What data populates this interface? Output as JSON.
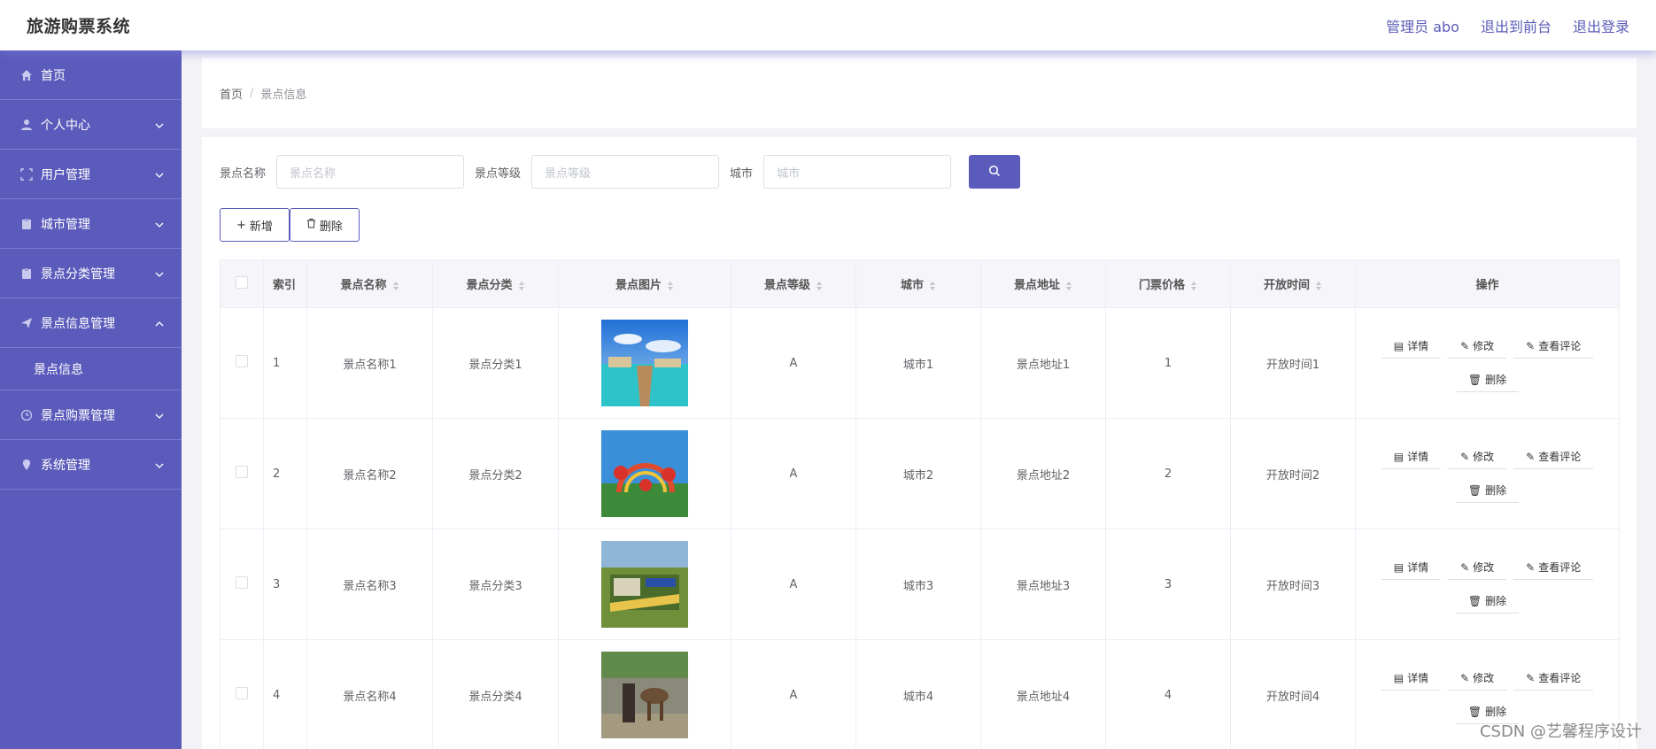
{
  "app": {
    "title": "旅游购票系统"
  },
  "header": {
    "admin": "管理员 abo",
    "to_front": "退出到前台",
    "logout": "退出登录"
  },
  "sidebar": {
    "items": [
      {
        "label": "首页"
      },
      {
        "label": "个人中心"
      },
      {
        "label": "用户管理"
      },
      {
        "label": "城市管理"
      },
      {
        "label": "景点分类管理"
      },
      {
        "label": "景点信息管理"
      },
      {
        "label": "景点购票管理"
      },
      {
        "label": "系统管理"
      }
    ],
    "sub_item": "景点信息"
  },
  "breadcrumb": {
    "home": "首页",
    "sep": "/",
    "current": "景点信息"
  },
  "search": {
    "name_label": "景点名称",
    "name_placeholder": "景点名称",
    "level_label": "景点等级",
    "level_placeholder": "景点等级",
    "city_label": "城市",
    "city_placeholder": "城市"
  },
  "actions": {
    "add": "新增",
    "delete": "删除"
  },
  "table": {
    "headers": [
      "索引",
      "景点名称",
      "景点分类",
      "景点图片",
      "景点等级",
      "城市",
      "景点地址",
      "门票价格",
      "开放时间",
      "操作"
    ],
    "rows": [
      {
        "index": "1",
        "name": "景点名称1",
        "category": "景点分类1",
        "level": "A",
        "city": "城市1",
        "address": "景点地址1",
        "price": "1",
        "open": "开放时间1"
      },
      {
        "index": "2",
        "name": "景点名称2",
        "category": "景点分类2",
        "level": "A",
        "city": "城市2",
        "address": "景点地址2",
        "price": "2",
        "open": "开放时间2"
      },
      {
        "index": "3",
        "name": "景点名称3",
        "category": "景点分类3",
        "level": "A",
        "city": "城市3",
        "address": "景点地址3",
        "price": "3",
        "open": "开放时间3"
      },
      {
        "index": "4",
        "name": "景点名称4",
        "category": "景点分类4",
        "level": "A",
        "city": "城市4",
        "address": "景点地址4",
        "price": "4",
        "open": "开放时间4"
      }
    ],
    "ops": {
      "detail": "详情",
      "edit": "修改",
      "comments": "查看评论",
      "delete": "删除"
    }
  },
  "watermark": "CSDN @艺馨程序设计",
  "colors": {
    "primary": "#5b5bbc",
    "sidebar": "#5b5bbc"
  }
}
